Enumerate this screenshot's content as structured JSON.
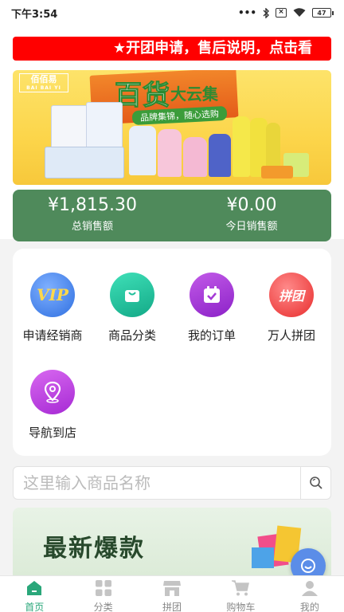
{
  "status_bar": {
    "time": "下午3:54",
    "battery": "47"
  },
  "notice": {
    "text": "★开团申请，售后说明，点击看"
  },
  "banner": {
    "logo": "佰佰易",
    "logo_sub": "BAI BAI YI",
    "title": "百货",
    "title2": "大云集",
    "subtitle": "品牌集锦，随心选购"
  },
  "sales": {
    "total_amount": "¥1,815.30",
    "total_label": "总销售额",
    "today_amount": "¥0.00",
    "today_label": "今日销售额"
  },
  "menu": {
    "items": [
      {
        "label": "申请经销商",
        "icon": "vip-icon",
        "icon_text": "VIP",
        "color": "#3e7de8"
      },
      {
        "label": "商品分类",
        "icon": "bag-icon",
        "color": "#1fbf9a"
      },
      {
        "label": "我的订单",
        "icon": "calendar-check-icon",
        "color": "#a53bd6"
      },
      {
        "label": "万人拼团",
        "icon": "group-buy-icon",
        "icon_text": "拼团",
        "color": "#f24545"
      },
      {
        "label": "导航到店",
        "icon": "location-pin-icon",
        "color": "#c03adf"
      }
    ]
  },
  "search": {
    "placeholder": "这里输入商品名称"
  },
  "promo": {
    "text": "最新爆款"
  },
  "tabbar": {
    "items": [
      {
        "label": "首页",
        "icon": "home-icon",
        "active": true
      },
      {
        "label": "分类",
        "icon": "grid-icon",
        "active": false
      },
      {
        "label": "拼团",
        "icon": "store-icon",
        "active": false
      },
      {
        "label": "购物车",
        "icon": "cart-icon",
        "active": false
      },
      {
        "label": "我的",
        "icon": "user-icon",
        "active": false
      }
    ]
  },
  "colors": {
    "accent": "#2aa77a",
    "notice_bg": "#ff0000",
    "sales_bg": "#4f8a5b"
  }
}
